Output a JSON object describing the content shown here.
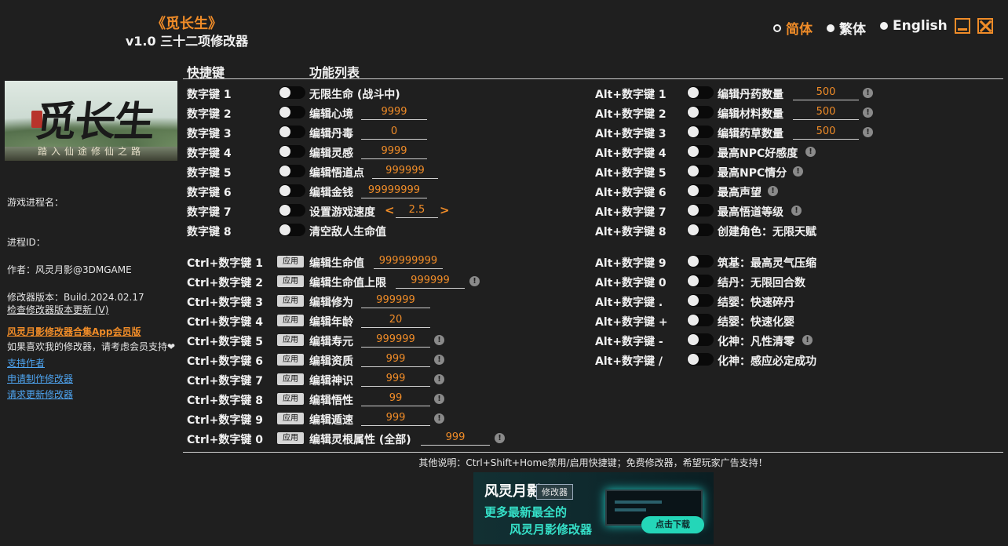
{
  "header": {
    "title": "《觅长生》",
    "subtitle": "v1.0 三十二项修改器",
    "languages": [
      {
        "label": "简体",
        "active": true
      },
      {
        "label": "繁体",
        "active": false
      },
      {
        "label": "English",
        "active": false
      }
    ]
  },
  "banner": {
    "title_art": "觅长生",
    "seal": "觅",
    "motto": "踏入仙途修仙之路"
  },
  "sidebar": {
    "process_name_label": "游戏进程名：",
    "process_id_label": "进程ID：",
    "author": "作者：风灵月影@3DMGAME",
    "version": "修改器版本：Build.2024.02.17",
    "check_update": "检查修改器版本更新 (V)",
    "vip_link": "风灵月影修改器合集App会员版",
    "support_text": "如果喜欢我的修改器，请考虑会员支持",
    "support_heart": "❤",
    "links": [
      "支持作者",
      "申请制作修改器",
      "请求更新修改器"
    ]
  },
  "columns": {
    "hotkey": "快捷键",
    "features": "功能列表"
  },
  "left_toggles": [
    {
      "key": "数字键 1",
      "name": "无限生命 (战斗中)"
    },
    {
      "key": "数字键 2",
      "name": "编辑心境",
      "value": "9999"
    },
    {
      "key": "数字键 3",
      "name": "编辑丹毒",
      "value": "0"
    },
    {
      "key": "数字键 4",
      "name": "编辑灵感",
      "value": "9999"
    },
    {
      "key": "数字键 5",
      "name": "编辑悟道点",
      "value": "999999"
    },
    {
      "key": "数字键 6",
      "name": "编辑金钱",
      "value": "99999999"
    },
    {
      "key": "数字键 7",
      "name": "设置游戏速度",
      "value": "2.5",
      "stepper": true
    },
    {
      "key": "数字键 8",
      "name": "清空敌人生命值"
    }
  ],
  "apply_rows": [
    {
      "key": "Ctrl+数字键 1",
      "button": "应用",
      "name": "编辑生命值",
      "value": "999999999",
      "info": false
    },
    {
      "key": "Ctrl+数字键 2",
      "button": "应用",
      "name": "编辑生命值上限",
      "value": "999999",
      "info": true
    },
    {
      "key": "Ctrl+数字键 3",
      "button": "应用",
      "name": "编辑修为",
      "value": "999999",
      "info": false
    },
    {
      "key": "Ctrl+数字键 4",
      "button": "应用",
      "name": "编辑年龄",
      "value": "20",
      "info": false
    },
    {
      "key": "Ctrl+数字键 5",
      "button": "应用",
      "name": "编辑寿元",
      "value": "999999",
      "info": true
    },
    {
      "key": "Ctrl+数字键 6",
      "button": "应用",
      "name": "编辑资质",
      "value": "999",
      "info": true
    },
    {
      "key": "Ctrl+数字键 7",
      "button": "应用",
      "name": "编辑神识",
      "value": "999",
      "info": true
    },
    {
      "key": "Ctrl+数字键 8",
      "button": "应用",
      "name": "编辑悟性",
      "value": "99",
      "info": true
    },
    {
      "key": "Ctrl+数字键 9",
      "button": "应用",
      "name": "编辑遁速",
      "value": "999",
      "info": true
    },
    {
      "key": "Ctrl+数字键 0",
      "button": "应用",
      "name": "编辑灵根属性 (全部)",
      "value": "999",
      "info": true
    }
  ],
  "right_toggles": [
    {
      "key": "Alt+数字键 1",
      "name": "编辑丹药数量",
      "value": "500",
      "info": true
    },
    {
      "key": "Alt+数字键 2",
      "name": "编辑材料数量",
      "value": "500",
      "info": true
    },
    {
      "key": "Alt+数字键 3",
      "name": "编辑药草数量",
      "value": "500",
      "info": true
    },
    {
      "key": "Alt+数字键 4",
      "name": "最高NPC好感度",
      "info": true
    },
    {
      "key": "Alt+数字键 5",
      "name": "最高NPC情分",
      "info": true
    },
    {
      "key": "Alt+数字键 6",
      "name": "最高声望",
      "info": true
    },
    {
      "key": "Alt+数字键 7",
      "name": "最高悟道等级",
      "info": true
    },
    {
      "key": "Alt+数字键 8",
      "name": "创建角色：无限天赋",
      "info": false
    }
  ],
  "right_toggles_2": [
    {
      "key": "Alt+数字键 9",
      "name": "筑基：最高灵气压缩",
      "info": false
    },
    {
      "key": "Alt+数字键 0",
      "name": "结丹：无限回合数",
      "info": false
    },
    {
      "key": "Alt+数字键 .",
      "name": "结婴：快速碎丹",
      "info": false
    },
    {
      "key": "Alt+数字键 +",
      "name": "结婴：快速化婴",
      "info": false
    },
    {
      "key": "Alt+数字键 -",
      "name": "化神：凡性清零",
      "info": true
    },
    {
      "key": "Alt+数字键 /",
      "name": "化神：感应必定成功",
      "info": false
    }
  ],
  "footer_note": "其他说明：Ctrl+Shift+Home禁用/启用快捷键；免费修改器，希望玩家广告支持！",
  "ad": {
    "logo": "风灵月影",
    "tag": "修改器",
    "line1": "更多最新最全的",
    "line2": "风灵月影修改器",
    "cta": "点击下载"
  },
  "colors": {
    "accent": "#f08c28",
    "background": "#1f1f1f",
    "text": "#f2f2f2",
    "link": "#4ea4f0"
  }
}
